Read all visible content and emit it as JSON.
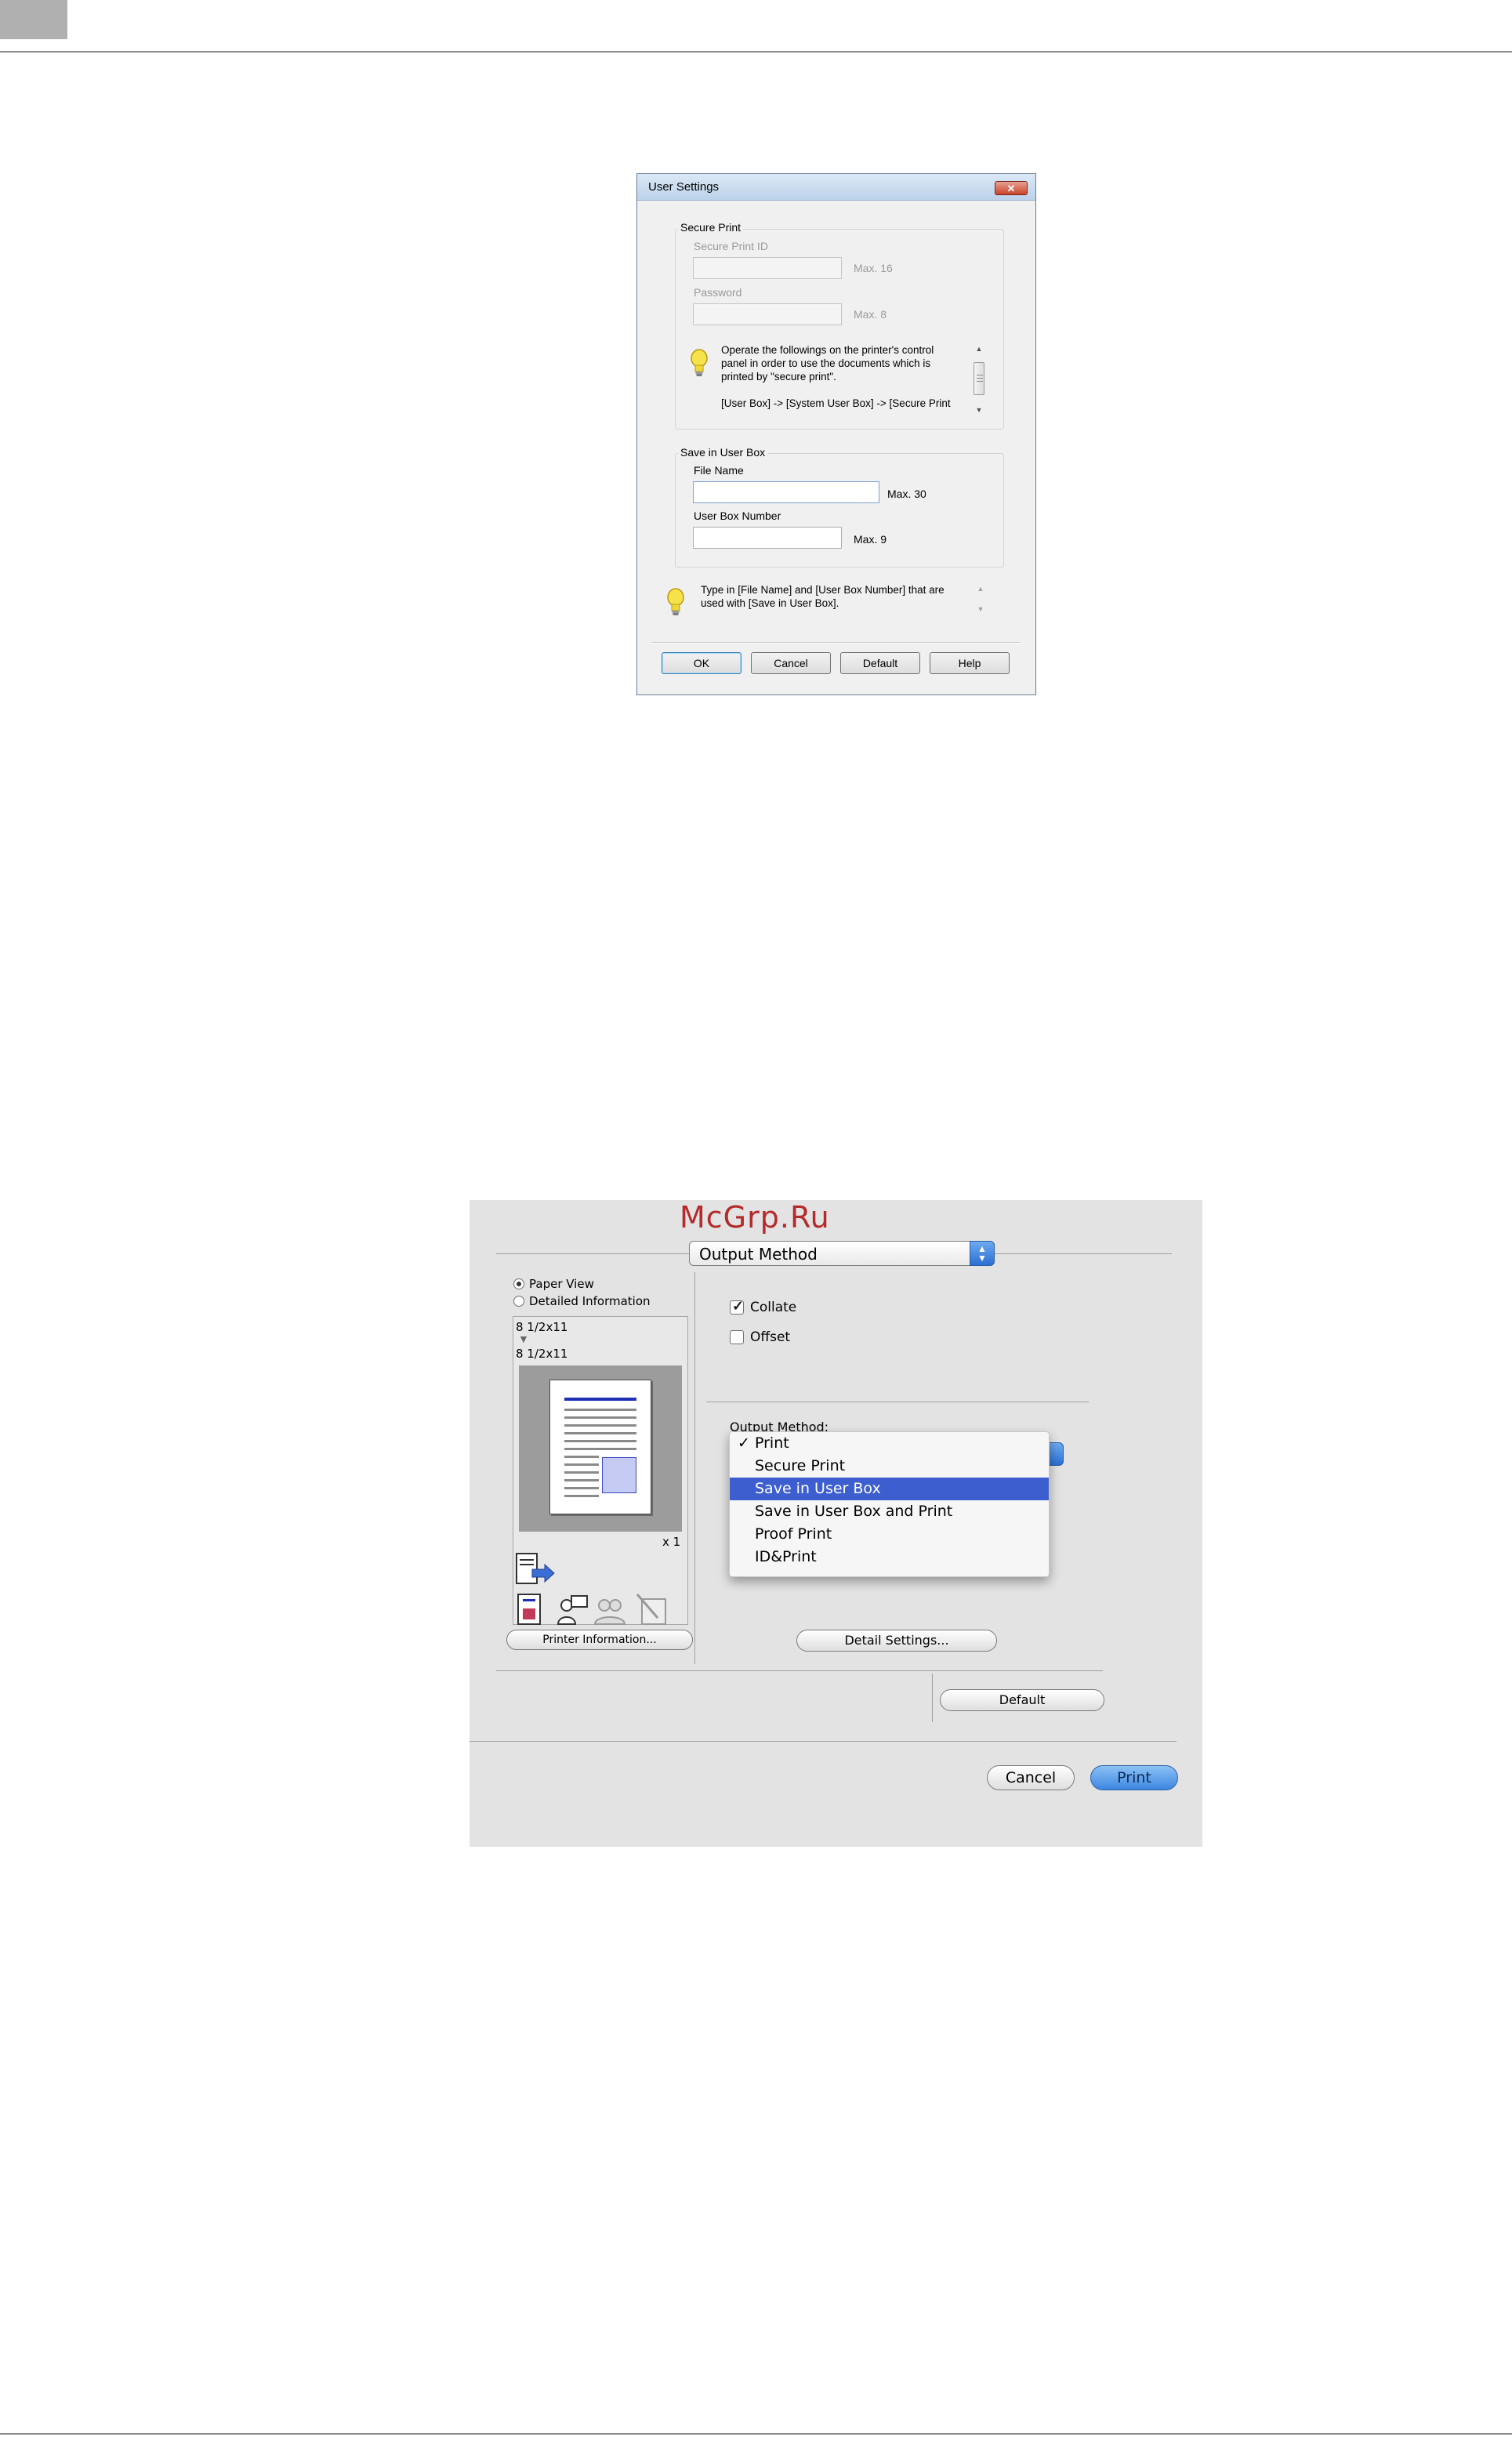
{
  "win": {
    "title": "User Settings",
    "close": "✕",
    "secure_print": {
      "legend": "Secure Print",
      "id_label": "Secure Print ID",
      "id_max": "Max. 16",
      "password_label": "Password",
      "password_max": "Max. 8",
      "note_lines": [
        "Operate the followings on the printer's control",
        "panel in order to use the documents which is",
        "printed by \"secure print\"."
      ],
      "note_path": "[User Box] -> [System User Box] -> [Secure Print"
    },
    "user_box": {
      "legend": "Save in User Box",
      "file_label": "File Name",
      "file_value": "",
      "file_max": "Max. 30",
      "number_label": "User Box Number",
      "number_value": "",
      "number_max": "Max. 9"
    },
    "hint_lines": [
      "Type in [File Name] and [User Box Number] that are",
      "used with [Save in User Box]."
    ],
    "buttons": {
      "ok": "OK",
      "cancel": "Cancel",
      "default": "Default",
      "help": "Help"
    }
  },
  "mac": {
    "watermark": "McGrp.Ru",
    "panel": "Output Method",
    "view": {
      "paper": "Paper View",
      "detail": "Detailed Information"
    },
    "paper_in": "8 1/2x11",
    "paper_out": "8 1/2x11",
    "copies": "x 1",
    "printer_info": "Printer Information...",
    "collate": "Collate",
    "offset": "Offset",
    "output_method_label": "Output Method:",
    "menu": {
      "checkmark": "✓",
      "items": [
        "Print",
        "Secure Print",
        "Save in User Box",
        "Save in User Box and Print",
        "Proof Print",
        "ID&Print"
      ],
      "selected": "Save in User Box"
    },
    "detail_settings": "Detail Settings...",
    "default": "Default",
    "cancel": "Cancel",
    "print": "Print"
  }
}
